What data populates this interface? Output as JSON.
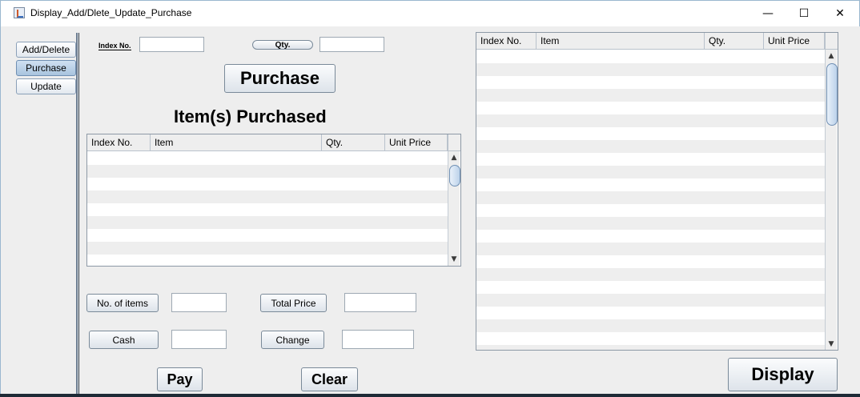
{
  "window": {
    "title": "Display_Add/Dlete_Update_Purchase",
    "minimize_glyph": "—",
    "maximize_glyph": "☐",
    "close_glyph": "✕"
  },
  "tabs": [
    {
      "label": "Add/Delete"
    },
    {
      "label": "Purchase"
    },
    {
      "label": "Update"
    }
  ],
  "purchase_form": {
    "index_label": "Index No.",
    "index_value": "",
    "qty_label": "Qty.",
    "qty_value": "",
    "purchase_button": "Purchase",
    "items_heading": "Item(s) Purchased"
  },
  "purchased_table": {
    "columns": [
      "Index No.",
      "Item",
      "Qty.",
      "Unit Price"
    ],
    "rows": []
  },
  "summary": {
    "no_items_label": "No. of items",
    "no_items_value": "",
    "total_price_label": "Total Price",
    "total_price_value": "",
    "cash_label": "Cash",
    "cash_value": "",
    "change_label": "Change",
    "change_value": "",
    "pay_button": "Pay",
    "clear_button": "Clear"
  },
  "inventory_table": {
    "columns": [
      "Index No.",
      "Item",
      "Qty.",
      "Unit Price"
    ],
    "rows": []
  },
  "display_button": "Display"
}
